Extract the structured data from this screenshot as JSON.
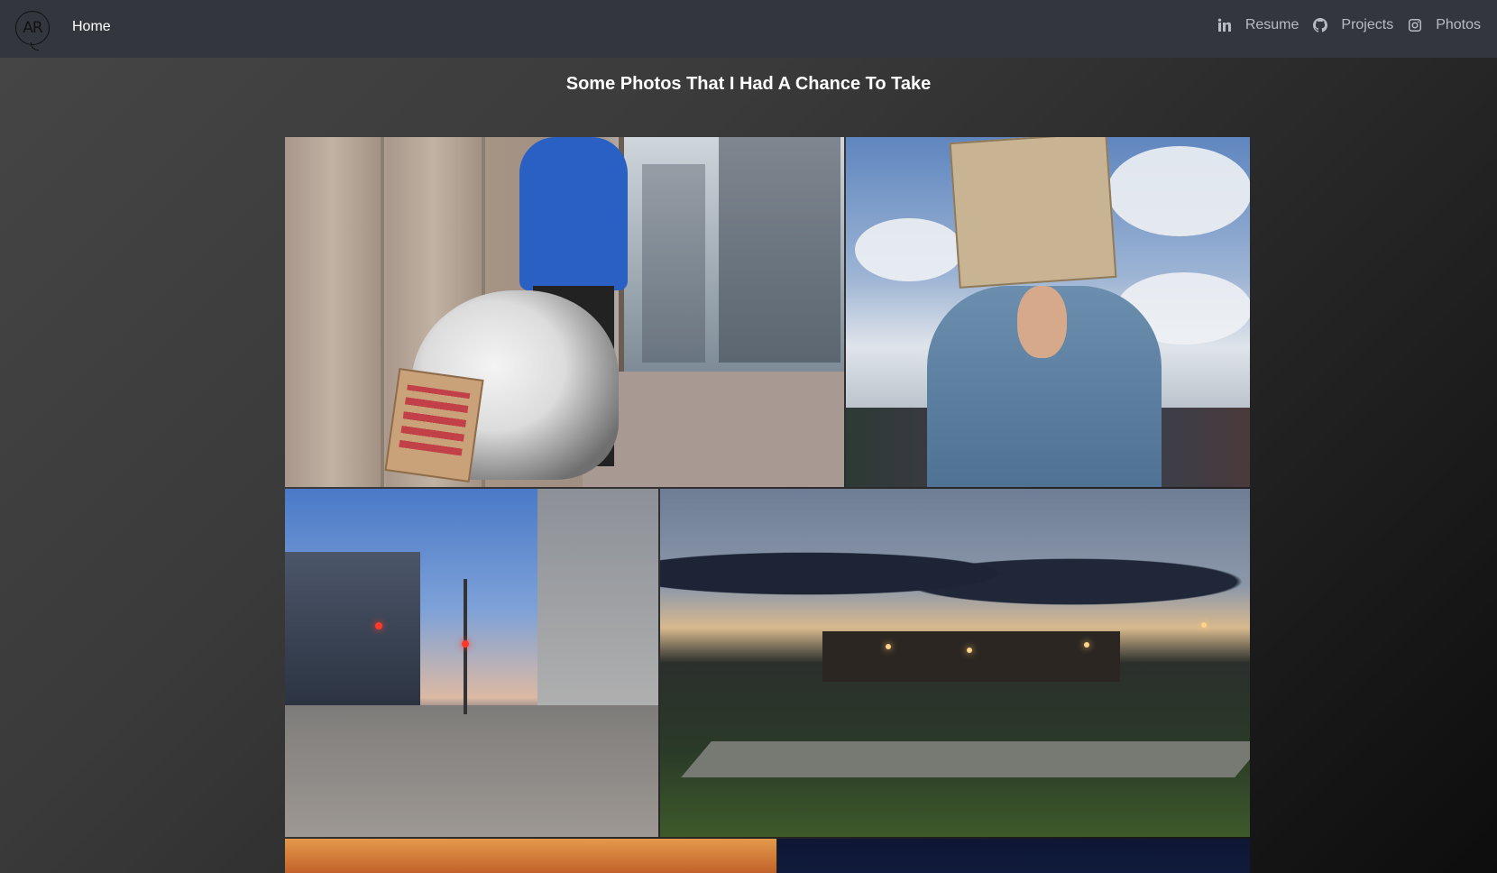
{
  "navbar": {
    "logo_text": "AR",
    "home_label": "Home",
    "links": [
      {
        "icon": "linkedin-icon",
        "label": "Resume"
      },
      {
        "icon": "github-icon",
        "label": "Projects"
      },
      {
        "icon": "instagram-icon",
        "label": "Photos"
      }
    ]
  },
  "page": {
    "title": "Some Photos That I Had A Chance To Take"
  },
  "colors": {
    "navbar_bg": "#33373d",
    "nav_link": "#b8bcc2",
    "title": "#ffffff"
  }
}
